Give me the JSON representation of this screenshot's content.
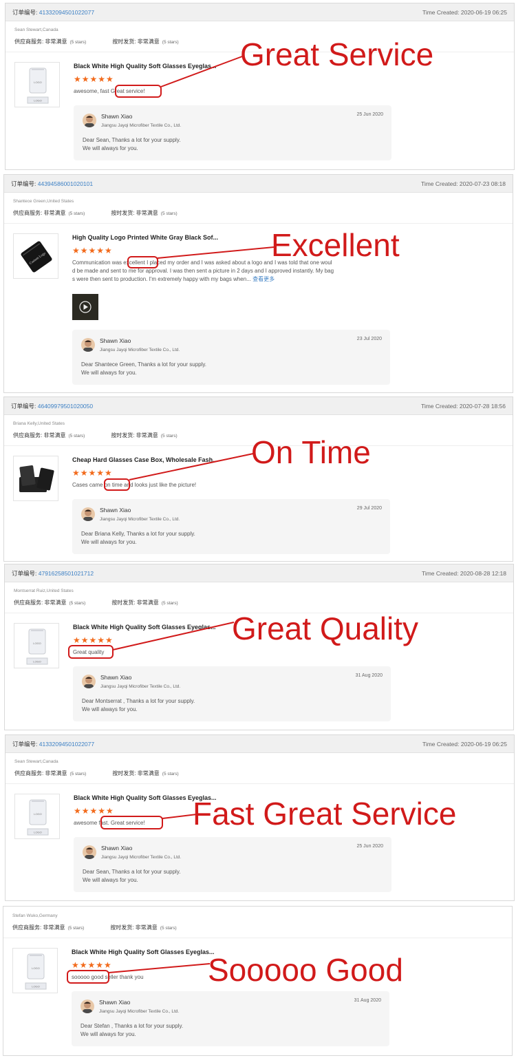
{
  "labels": {
    "order_prefix": "订单编号:",
    "time_prefix": "Time Created:",
    "supplier_service": "供应商服务:",
    "on_time": "按时发货:",
    "very_satisfied": "非常满意",
    "five_stars": "(5 stars)",
    "stars": "★★★★★"
  },
  "colors": {
    "annotation": "#d11a1a",
    "stars": "#f26a1b",
    "link": "#3b7fc4"
  },
  "reviews": [
    {
      "order_no": "41332094501022077",
      "time": "2020-06-19 06:25",
      "buyer": "Sean Stewart,Canada",
      "product": "Black White High Quality Soft Glasses Eyeglas...",
      "thumb_icon": "white-pouch-icon",
      "review_pre": "awesome, fast",
      "review_hl": "Great service!",
      "review_post": "",
      "reply": {
        "name": "Shawn Xiao",
        "company": "Jiangsu Jayqi Microfiber Textile Co., Ltd.",
        "date": "25 Jun 2020",
        "line1": "Dear Sean, Thanks a lot  for your supply.",
        "line2": "We will always for you."
      },
      "annotation": "Great Service"
    },
    {
      "order_no": "44394586001020101",
      "time": "2020-07-23 08:18",
      "buyer": "Shantece Green,United States",
      "product": "High Quality Logo Printed White Gray Black Sof...",
      "thumb_icon": "black-pouch-icon",
      "review_pre": "Communication was",
      "review_hl": "excellent",
      "review_post": "I placed my order and I was asked about a logo and I was told that one woul",
      "review_line2": "d be made and sent to me for approval. I was then sent a picture in 2 days and I approved instantly. My bag",
      "review_line3": "s were then sent to production. I'm extremely happy with my bags when...",
      "see_more": "查看更多",
      "video_icon": "video-play-icon",
      "reply": {
        "name": "Shawn Xiao",
        "company": "Jiangsu Jayqi Microfiber Textile Co., Ltd.",
        "date": "23 Jul 2020",
        "line1": "Dear Shantece Green, Thanks a lot  for your supply.",
        "line2": "We will always for you."
      },
      "annotation": "Excellent"
    },
    {
      "order_no": "46409979501020050",
      "time": "2020-07-28 18:56",
      "buyer": "Briana Kelly,United States",
      "product": "Cheap Hard Glasses Case Box, Wholesale Fash...",
      "thumb_icon": "black-case-icon",
      "review_pre": "Cases came",
      "review_hl": "on time",
      "review_post": "and looks just like the picture!",
      "reply": {
        "name": "Shawn Xiao",
        "company": "Jiangsu Jayqi Microfiber Textile Co., Ltd.",
        "date": "29 Jul 2020",
        "line1": "Dear Briana Kelly, Thanks a lot  for your supply.",
        "line2": "We will always for you."
      },
      "annotation": "On Time"
    },
    {
      "order_no": "47916258501021712",
      "time": "2020-08-28 12:18",
      "buyer": "Montserrat Ruiz,United States",
      "product": "Black White High Quality Soft Glasses Eyeglas...",
      "thumb_icon": "white-pouch-icon",
      "review_pre": "",
      "review_hl": "Great quality",
      "review_post": "",
      "reply": {
        "name": "Shawn Xiao",
        "company": "Jiangsu Jayqi Microfiber Textile Co., Ltd.",
        "date": "31 Aug 2020",
        "line1": "Dear Montserrat , Thanks a lot  for your supply.",
        "line2": "We will always for you."
      },
      "annotation": "Great Quality"
    },
    {
      "order_no": "41332094501022077",
      "time": "2020-06-19 06:25",
      "buyer": "Sean Stewart,Canada",
      "product": "Black White High Quality Soft Glasses Eyeglas...",
      "thumb_icon": "white-pouch-icon",
      "review_pre": "awesome",
      "review_hl": "fast. Great service!",
      "review_post": "",
      "reply": {
        "name": "Shawn Xiao",
        "company": "Jiangsu Jayqi Microfiber Textile Co., Ltd.",
        "date": "25 Jun 2020",
        "line1": "Dear Sean, Thanks a lot  for your supply.",
        "line2": "We will always for you."
      },
      "annotation": "Fast Great Service"
    },
    {
      "buyer": "Stefan Wuko,Germany",
      "product": "Black White High Quality Soft Glasses Eyeglas...",
      "thumb_icon": "white-pouch-icon",
      "review_pre": "",
      "review_hl": "sooooo good",
      "review_post": "seller thank you",
      "reply": {
        "name": "Shawn Xiao",
        "company": "Jiangsu Jayqi Microfiber Textile Co., Ltd.",
        "date": "31 Aug 2020",
        "line1": "Dear Stefan , Thanks a lot  for your supply.",
        "line2": "We will always for you."
      },
      "annotation": "Sooooo Good"
    }
  ]
}
